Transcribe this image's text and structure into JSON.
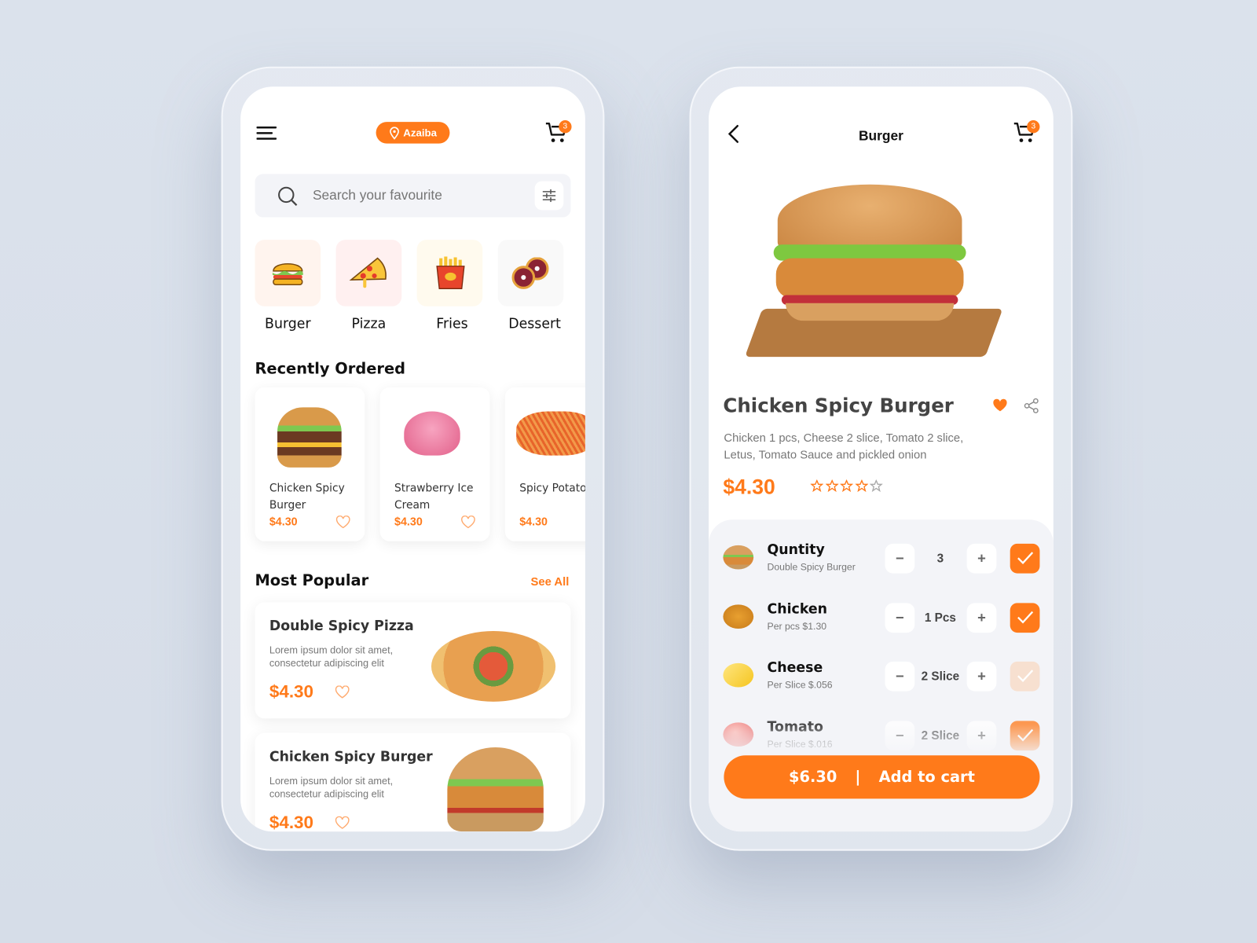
{
  "colors": {
    "accent": "#ff7a1a",
    "background": "#d9e0ea",
    "panel": "#f3f4f8"
  },
  "home": {
    "location": "Azaiba",
    "cart_count": "3",
    "search": {
      "placeholder": "Search your favourite"
    },
    "categories": [
      {
        "label": "Burger",
        "bg": "#fff4ee"
      },
      {
        "label": "Pizza",
        "bg": "#fff0f0"
      },
      {
        "label": "Fries",
        "bg": "#fffaee"
      },
      {
        "label": "Dessert",
        "bg": "#f9f9f9"
      }
    ],
    "recent_title": "Recently Ordered",
    "recent": [
      {
        "name": "Chicken Spicy Burger",
        "price": "$4.30"
      },
      {
        "name": "Strawberry Ice Cream",
        "price": "$4.30"
      },
      {
        "name": "Spicy Potato Fries",
        "price": "$4.30"
      }
    ],
    "popular_title": "Most Popular",
    "see_all": "See All",
    "popular": [
      {
        "title": "Double Spicy Pizza",
        "desc": "Lorem ipsum dolor sit amet, consectetur adipiscing elit",
        "price": "$4.30"
      },
      {
        "title": "Chicken Spicy Burger",
        "desc": "Lorem ipsum dolor sit amet, consectetur adipiscing elit",
        "price": "$4.30"
      }
    ]
  },
  "detail": {
    "title": "Burger",
    "cart_count": "3",
    "product": {
      "name": "Chicken Spicy Burger",
      "desc": "Chicken 1 pcs, Cheese 2 slice, Tomato 2 slice, Letus, Tomato Sauce and pickled onion",
      "price": "$4.30",
      "rating": 4,
      "rating_max": 5,
      "favorited": true
    },
    "options": [
      {
        "label": "Quntity",
        "sub": "Double Spicy Burger",
        "value": "3",
        "checked": true
      },
      {
        "label": "Chicken",
        "sub": "Per pcs $1.30",
        "value": "1 Pcs",
        "checked": true
      },
      {
        "label": "Cheese",
        "sub": "Per Slice $.056",
        "value": "2 Slice",
        "checked": false
      },
      {
        "label": "Tomato",
        "sub": "Per Slice $.016",
        "value": "2 Slice",
        "checked": true
      }
    ],
    "total": "$6.30",
    "separator": "|",
    "add_label": "Add to cart"
  }
}
